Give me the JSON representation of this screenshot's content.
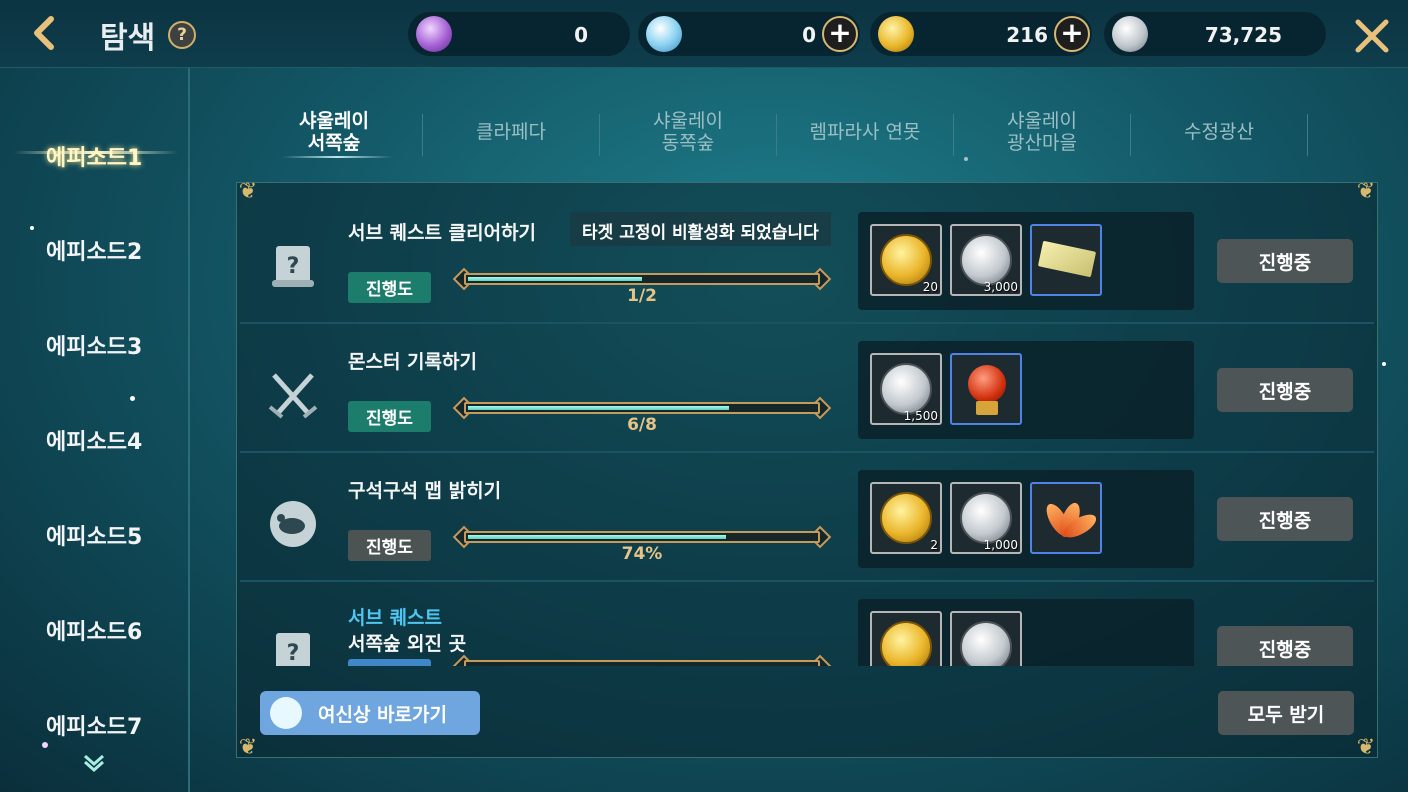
{
  "header": {
    "title": "탐색",
    "help_glyph": "?",
    "currencies": [
      {
        "name": "purple-gem",
        "value": "0",
        "plus": false,
        "color": "#a45fd4"
      },
      {
        "name": "blue-crystal",
        "value": "0",
        "plus": true,
        "color": "#8fd4f2"
      },
      {
        "name": "gold-coin",
        "value": "216",
        "plus": true,
        "color": "#e9b62a"
      },
      {
        "name": "silver-coin",
        "value": "73,725",
        "plus": false,
        "color": "#bfc6cc"
      }
    ],
    "plus_glyph": "+"
  },
  "sidebar": {
    "items": [
      {
        "label": "에피소드1",
        "active": true
      },
      {
        "label": "에피소드2",
        "active": false
      },
      {
        "label": "에피소드3",
        "active": false
      },
      {
        "label": "에피소드4",
        "active": false
      },
      {
        "label": "에피소드5",
        "active": false
      },
      {
        "label": "에피소드6",
        "active": false
      },
      {
        "label": "에피소드7",
        "active": false
      }
    ]
  },
  "tabs": [
    {
      "label": "샤울레이\n서쪽숲",
      "active": true
    },
    {
      "label": "클라페다",
      "active": false
    },
    {
      "label": "샤울레이\n동쪽숲",
      "active": false
    },
    {
      "label": "렘파라사 연못",
      "active": false
    },
    {
      "label": "샤울레이\n광산마을",
      "active": false
    },
    {
      "label": "수정광산",
      "active": false
    }
  ],
  "quests": [
    {
      "category": "",
      "name": "서브 퀘스트 클리어하기",
      "notice": "타겟 고정이 비활성화 되었습니다",
      "badge": "진행도",
      "badge_style": "green",
      "progress_text": "1/2",
      "progress": 0.5,
      "icon": "quest-scroll-icon",
      "rewards": [
        {
          "type": "gold-coin",
          "count": "20"
        },
        {
          "type": "silver-coin",
          "count": "3,000"
        },
        {
          "type": "ticket",
          "count": ""
        }
      ],
      "status": "진행중"
    },
    {
      "category": "",
      "name": "몬스터 기록하기",
      "notice": "",
      "badge": "진행도",
      "badge_style": "green",
      "progress_text": "6/8",
      "progress": 0.75,
      "icon": "crossed-swords-icon",
      "rewards": [
        {
          "type": "silver-coin",
          "count": "1,500"
        },
        {
          "type": "red-gem",
          "count": ""
        }
      ],
      "status": "진행중"
    },
    {
      "category": "",
      "name": "구석구석 맵 밝히기",
      "notice": "",
      "badge": "진행도",
      "badge_style": "gray",
      "progress_text": "74%",
      "progress": 0.74,
      "icon": "map-explore-icon",
      "rewards": [
        {
          "type": "gold-coin",
          "count": "2"
        },
        {
          "type": "silver-coin",
          "count": "1,000"
        },
        {
          "type": "leaves",
          "count": ""
        }
      ],
      "status": "진행중"
    },
    {
      "category": "서브 퀘스트",
      "name": "서쪽숲 외진 곳",
      "notice": "",
      "badge": "",
      "badge_style": "blue",
      "progress_text": "",
      "progress": 0,
      "icon": "quest-scroll-icon",
      "rewards": [
        {
          "type": "gold-coin",
          "count": ""
        },
        {
          "type": "silver-coin",
          "count": ""
        }
      ],
      "status": "진행중"
    }
  ],
  "footer": {
    "goddess_button": "여신상 바로가기",
    "claim_all": "모두 받기"
  }
}
